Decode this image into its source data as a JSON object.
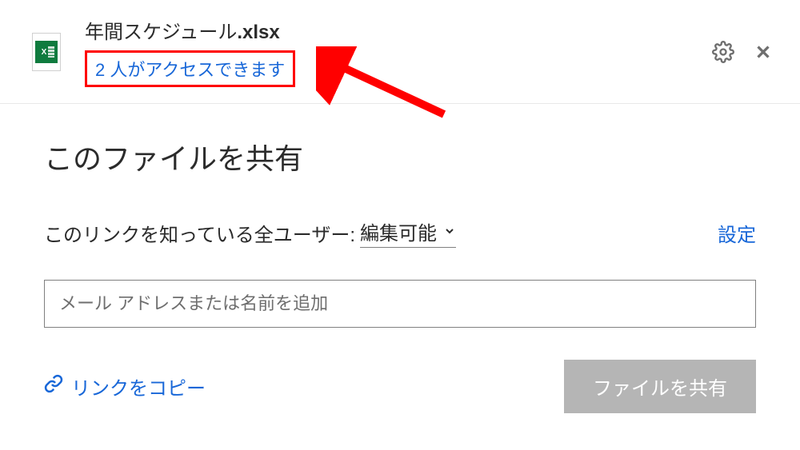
{
  "header": {
    "file_name_base": "年間スケジュール",
    "file_name_ext": ".xlsx",
    "access_info": "2 人がアクセスできます"
  },
  "content": {
    "share_title": "このファイルを共有",
    "link_label": "このリンクを知っている全ユーザー: ",
    "permission": "編集可能",
    "settings_link": "設定",
    "email_placeholder": "メール アドレスまたは名前を追加",
    "copy_link": "リンクをコピー",
    "share_button": "ファイルを共有"
  }
}
